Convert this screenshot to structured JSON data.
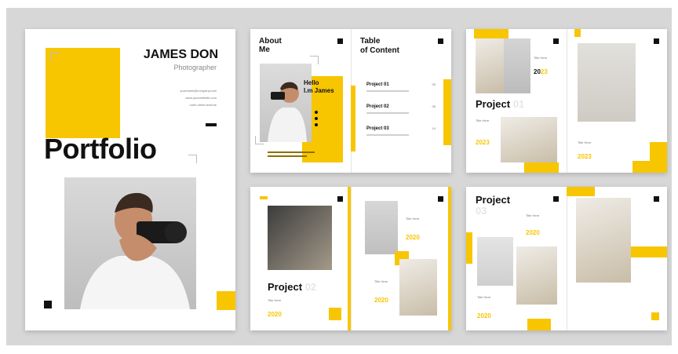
{
  "cover": {
    "name": "JAMES DON",
    "role": "Photographer",
    "contact": [
      "yourname@company.com",
      "www.yourwebsite.com",
      "north street avenue"
    ],
    "title": "Portfolio"
  },
  "spread1": {
    "about_title": "About\nMe",
    "hello": "Hello\nI.m James",
    "toc_title": "Table\nof Content",
    "toc_items": [
      {
        "label": "Project 01",
        "page": "05"
      },
      {
        "label": "Project 02",
        "page": "08"
      },
      {
        "label": "Project 03",
        "page": "10"
      }
    ]
  },
  "spread2": {
    "project_title": "Project",
    "project_num": "01",
    "title_here": "Title Here",
    "year_a": "20",
    "year_b": "23"
  },
  "spread3": {
    "project_title": "Project",
    "project_num": "02",
    "title_here": "Title Here",
    "year_a": "20",
    "year_b": "20"
  },
  "spread4": {
    "project_title": "Project",
    "project_num": "03",
    "title_here": "Title Here",
    "year_a": "20",
    "year_b": "20"
  }
}
